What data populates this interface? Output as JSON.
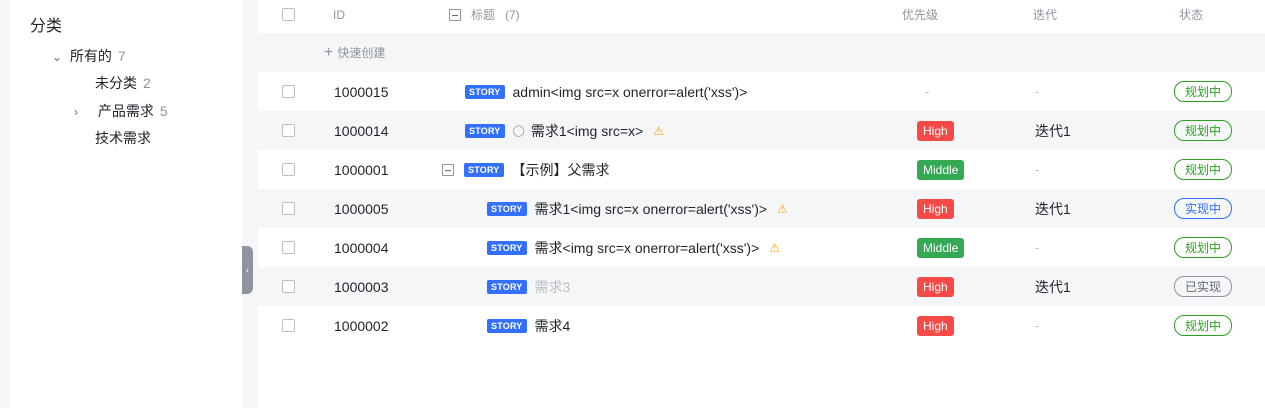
{
  "sidebar": {
    "title": "分类",
    "items": [
      {
        "label": "所有的",
        "count": "7"
      },
      {
        "label": "未分类",
        "count": "2"
      },
      {
        "label": "产品需求",
        "count": "5"
      },
      {
        "label": "技术需求",
        "count": ""
      }
    ]
  },
  "table": {
    "headers": {
      "id": "ID",
      "title": "标题",
      "title_count": "(7)",
      "priority": "优先级",
      "iteration": "迭代",
      "status": "状态"
    },
    "quick_create": "快速创建",
    "story_tag": "STORY",
    "rows": [
      {
        "id": "1000015",
        "title": "admin<img src=x onerror=alert('xss')>",
        "priority": "-",
        "iteration": "-",
        "status": "规划中"
      },
      {
        "id": "1000014",
        "title": "需求1<img src=x>",
        "priority": "High",
        "iteration": "迭代1",
        "status": "规划中"
      },
      {
        "id": "1000001",
        "title": "【示例】父需求",
        "priority": "Middle",
        "iteration": "-",
        "status": "规划中"
      },
      {
        "id": "1000005",
        "title": "需求1<img src=x onerror=alert('xss')>",
        "priority": "High",
        "iteration": "迭代1",
        "status": "实现中"
      },
      {
        "id": "1000004",
        "title": "需求<img src=x onerror=alert('xss')>",
        "priority": "Middle",
        "iteration": "-",
        "status": "规划中"
      },
      {
        "id": "1000003",
        "title": "需求3",
        "priority": "High",
        "iteration": "迭代1",
        "status": "已实现"
      },
      {
        "id": "1000002",
        "title": "需求4",
        "priority": "High",
        "iteration": "-",
        "status": "规划中"
      }
    ]
  },
  "colors": {
    "high": "#f54a45",
    "middle": "#34a853",
    "story": "#3370ff",
    "plan": "#2ea121",
    "impl": "#3370ff"
  }
}
